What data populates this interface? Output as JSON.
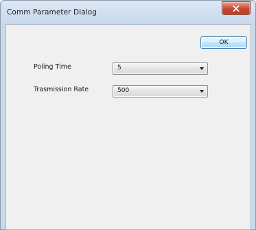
{
  "window": {
    "title": "Comm Parameter Dialog",
    "close_icon": "close-icon"
  },
  "dialog": {
    "ok_label": "OK",
    "fields": [
      {
        "label": "Poling Time",
        "value": "5"
      },
      {
        "label": "Trasmission Rate",
        "value": "500"
      }
    ]
  },
  "colors": {
    "frame": "#c9d9ec",
    "client_bg": "#f0f0f0",
    "close_button": "#c8472f",
    "ok_border": "#3c7fb1"
  }
}
